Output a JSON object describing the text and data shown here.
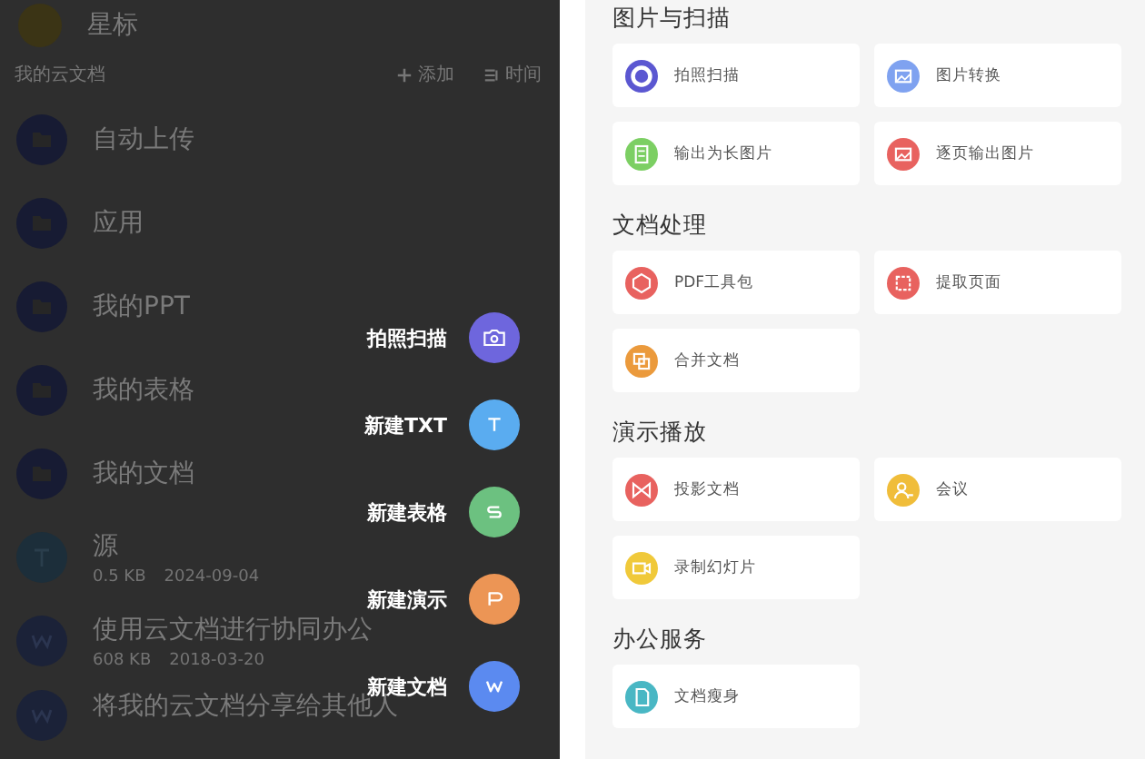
{
  "starred": {
    "label": "星标"
  },
  "cloud_docs": {
    "title": "我的云文档",
    "actions": [
      {
        "kind": "add",
        "label": "添加"
      },
      {
        "kind": "sort",
        "label": "时间"
      }
    ],
    "items": [
      {
        "kind": "folder",
        "name": "自动上传"
      },
      {
        "kind": "folder",
        "name": "应用"
      },
      {
        "kind": "folder",
        "name": "我的PPT"
      },
      {
        "kind": "folder",
        "name": "我的表格"
      },
      {
        "kind": "folder",
        "name": "我的文档"
      },
      {
        "kind": "txt",
        "name": "源",
        "size": "0.5 KB",
        "date": "2024-09-04"
      },
      {
        "kind": "doc",
        "name": "使用云文档进行协同办公",
        "size": "608 KB",
        "date": "2018-03-20"
      },
      {
        "kind": "doc",
        "name": "将我的云文档分享给其他人"
      }
    ]
  },
  "new_menu": [
    {
      "kind": "scan",
      "label": "拍照扫描",
      "color": "#6e66dd"
    },
    {
      "kind": "txt",
      "label": "新建TXT",
      "color": "#5aacf0"
    },
    {
      "kind": "sheet",
      "label": "新建表格",
      "color": "#6cc180"
    },
    {
      "kind": "slides",
      "label": "新建演示",
      "color": "#ec9555"
    },
    {
      "kind": "doc",
      "label": "新建文档",
      "color": "#5b8af0"
    }
  ],
  "tool_sections": [
    {
      "title": "图片与扫描",
      "tools": [
        {
          "kind": "scan",
          "label": "拍照扫描",
          "color": "#5b57d1"
        },
        {
          "kind": "image",
          "label": "图片转换",
          "color": "#7fa2f0"
        },
        {
          "kind": "longimage",
          "label": "输出为长图片",
          "color": "#7ccf63"
        },
        {
          "kind": "pageimage",
          "label": "逐页输出图片",
          "color": "#e8625f"
        }
      ]
    },
    {
      "title": "文档处理",
      "tools": [
        {
          "kind": "pdf",
          "label": "PDF工具包",
          "color": "#e8625f"
        },
        {
          "kind": "extract",
          "label": "提取页面",
          "color": "#e8625f"
        },
        {
          "kind": "merge",
          "label": "合并文档",
          "color": "#eb9a3c"
        }
      ]
    },
    {
      "title": "演示播放",
      "tools": [
        {
          "kind": "project",
          "label": "投影文档",
          "color": "#e8625f"
        },
        {
          "kind": "meeting",
          "label": "会议",
          "color": "#f0bd3a"
        },
        {
          "kind": "record",
          "label": "录制幻灯片",
          "color": "#f0c93a"
        }
      ]
    },
    {
      "title": "办公服务",
      "tools": [
        {
          "kind": "slim",
          "label": "文档瘦身",
          "color": "#49b7c4"
        }
      ]
    }
  ]
}
